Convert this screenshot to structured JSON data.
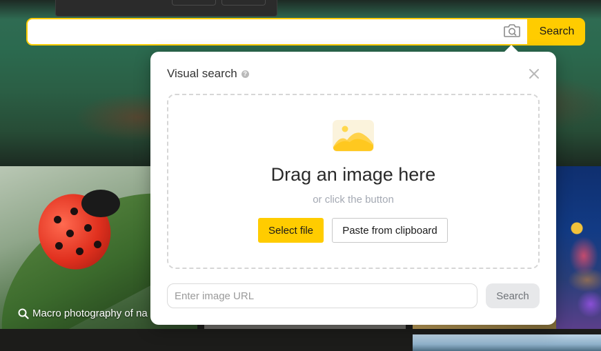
{
  "search_bar": {
    "query": "",
    "search_label": "Search",
    "camera_icon": "camera-icon",
    "accent_color": "#ffcc00"
  },
  "visual_search": {
    "title": "Visual search",
    "help_icon": "question-circle-icon",
    "close_icon": "close-icon",
    "dropzone": {
      "image_icon": "image-placeholder-icon",
      "headline": "Drag an image here",
      "subtext": "or click the button",
      "select_label": "Select file",
      "paste_label": "Paste from clipboard"
    },
    "url_placeholder": "Enter image URL",
    "url_search_label": "Search"
  },
  "gallery": {
    "caption": "Macro photography of na",
    "caption_icon": "search-icon"
  }
}
